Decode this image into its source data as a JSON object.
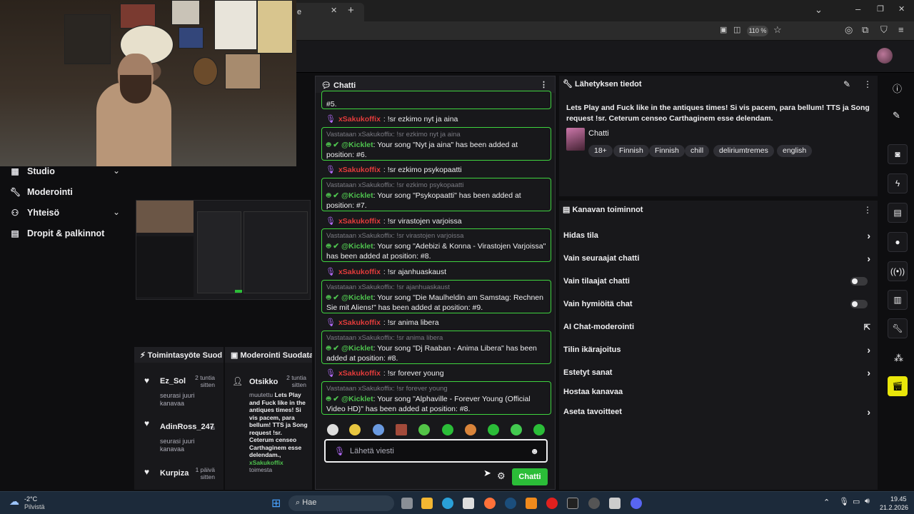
{
  "browser": {
    "tab_partial": "e",
    "zoom": "110 %"
  },
  "left_nav": {
    "items": [
      {
        "label": "Studio",
        "icon": "studio-icon",
        "has_chevron": true
      },
      {
        "label": "Moderointi",
        "icon": "wrench-icon",
        "has_chevron": false
      },
      {
        "label": "Yhteisö",
        "icon": "community-icon",
        "has_chevron": true
      },
      {
        "label": "Dropit & palkinnot",
        "icon": "gift-icon",
        "has_chevron": false
      }
    ]
  },
  "activity_feed": {
    "title": "Toimintasyöte",
    "title_suffix": "Suod",
    "items": [
      {
        "name": "Ez_Sol",
        "time": "2 tuntia sitten",
        "action": "seurasi juuri kanavaa"
      },
      {
        "name": "AdinRoss_247",
        "time": "ts",
        "action": "seurasi juuri kanavaa"
      },
      {
        "name": "Kurpiza",
        "time": "1 päivä sitten",
        "action": ""
      }
    ]
  },
  "mod_feed": {
    "title": "Moderointi",
    "title_suffix": "Suodata",
    "item": {
      "name": "Otsikko",
      "time": "2 tuntia sitten",
      "action": "muutettu",
      "value": "Lets Play and Fuck like in the antiques times! Si vis pacem, para bellum! TTS ja Song request !sr. Ceterum censeo Carthaginem esse delendam.,",
      "by": "xSakukoffix",
      "by_suffix": "toimesta"
    }
  },
  "chat": {
    "title": "Chatti",
    "top_cut": "#5.",
    "messages": [
      {
        "user": "xSakukoffix",
        "text": ": !sr ezkimo nyt ja aina",
        "reply_quote": "Vastataan xSakukoffix: !sr ezkimo nyt ja aina",
        "bot": "@Kicklet",
        "reply": ": Your song \"Nyt ja aina\" has been added at position: #6."
      },
      {
        "user": "xSakukoffix",
        "text": ": !sr ezkimo psykopaatti",
        "reply_quote": "Vastataan xSakukoffix: !sr ezkimo psykopaatti",
        "bot": "@Kicklet",
        "reply": ": Your song \"Psykopaatti\" has been added at position: #7."
      },
      {
        "user": "xSakukoffix",
        "text": ": !sr virastojen varjoissa",
        "reply_quote": "Vastataan xSakukoffix: !sr virastojen varjoissa",
        "bot": "@Kicklet",
        "reply": ": Your song \"Adebizi & Konna - Virastojen Varjoissa\" has been added at position: #8."
      },
      {
        "user": "xSakukoffix",
        "text": ": !sr ajanhuaskaust",
        "reply_quote": "Vastataan xSakukoffix: !sr ajanhuaskaust",
        "bot": "@Kicklet",
        "reply": ": Your song \"Die Maulheldin am Samstag: Rechnen Sie mit Aliens!\" has been added at position: #9."
      },
      {
        "user": "xSakukoffix",
        "text": ": !sr anima libera",
        "reply_quote": "Vastataan xSakukoffix: !sr anima libera",
        "bot": "@Kicklet",
        "reply": ": Your song \"Dj Raaban - Anima Libera\" has been added at position: #8."
      },
      {
        "user": "xSakukoffix",
        "text": ": !sr forever young",
        "reply_quote": "Vastataan xSakukoffix: !sr forever young",
        "bot": "@Kicklet",
        "reply": ": Your song \"Alphaville - Forever Young (Official Video HD)\" has been added at position: #8."
      }
    ],
    "input_placeholder": "Lähetä viesti",
    "send_label": "Chatti"
  },
  "stream_info": {
    "title": "Lähetyksen tiedot",
    "stream_title": "Lets Play and Fuck like in the antiques times! Si vis pacem, para bellum! TTS ja Song request !sr. Ceterum censeo Carthaginem esse delendam.",
    "category": "Chatti",
    "tags": [
      "18+",
      "Finnish",
      "Finnish",
      "chill",
      "deliriumtremes",
      "english"
    ]
  },
  "channel_actions": {
    "title": "Kanavan toiminnot",
    "rows": [
      {
        "label": "Hidas tila",
        "control": "chevron"
      },
      {
        "label": "Vain seuraajat chatti",
        "control": "chevron"
      },
      {
        "label": "Vain tilaajat chatti",
        "control": "toggle"
      },
      {
        "label": "Vain hymiöitä chat",
        "control": "toggle"
      },
      {
        "label": "AI Chat-moderointi",
        "control": "external"
      },
      {
        "label": "Tilin ikärajoitus",
        "control": "chevron"
      },
      {
        "label": "Estetyt sanat",
        "control": "chevron"
      },
      {
        "label": "Hostaa kanavaa",
        "control": "none"
      },
      {
        "label": "Aseta tavoitteet",
        "control": "chevron"
      }
    ]
  },
  "taskbar": {
    "weather_temp": "-2°C",
    "weather_desc": "Pilvistä",
    "search_label": "Hae",
    "time": "19.45",
    "date": "21.2.2026"
  },
  "colors": {
    "accent_green": "#2bbd38",
    "username_red": "#e23b3b",
    "bot_green": "#4ec24e"
  }
}
